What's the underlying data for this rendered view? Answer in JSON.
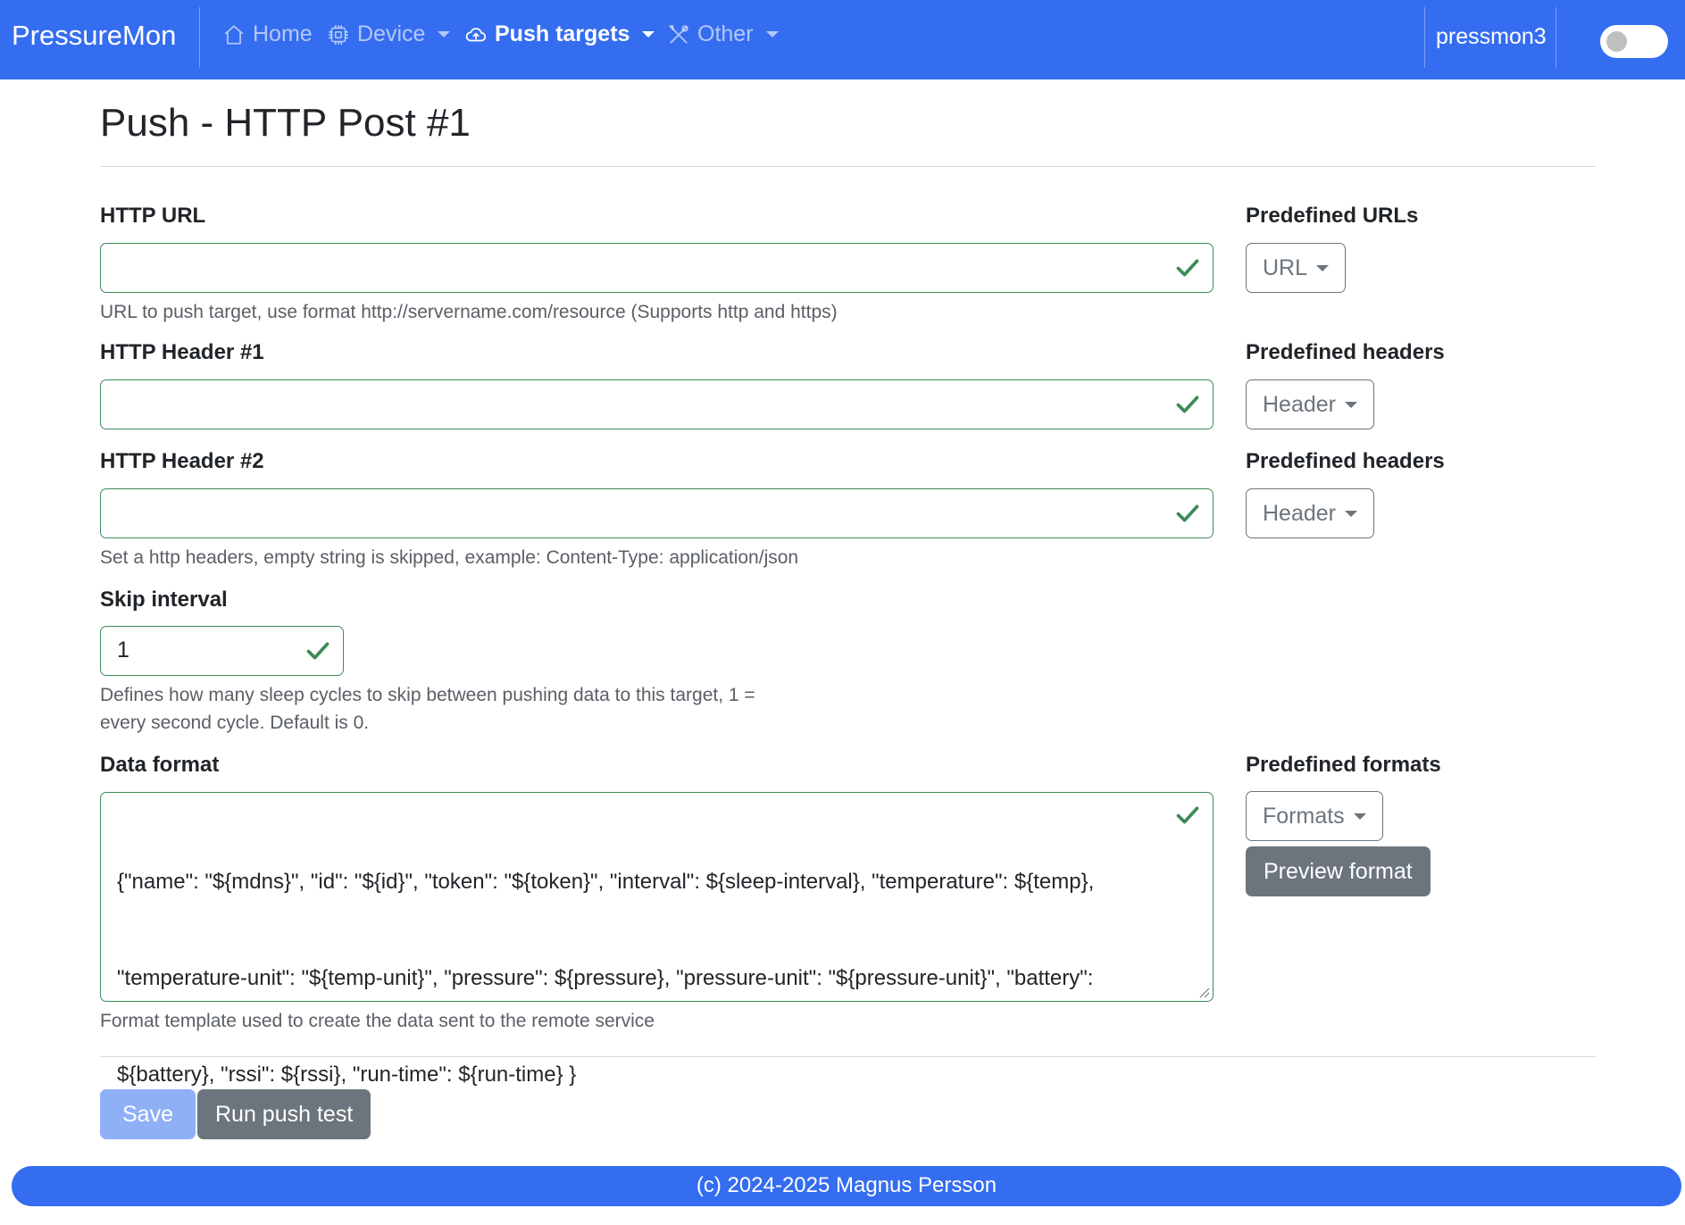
{
  "navbar": {
    "brand": "PressureMon",
    "items": [
      {
        "label": "Home",
        "icon": "house-icon",
        "active": false,
        "dropdown": false
      },
      {
        "label": "Device",
        "icon": "cpu-icon",
        "active": false,
        "dropdown": true
      },
      {
        "label": "Push targets",
        "icon": "cloud-upload-icon",
        "active": true,
        "dropdown": true
      },
      {
        "label": "Other",
        "icon": "tools-icon",
        "active": false,
        "dropdown": true
      }
    ],
    "hostname": "pressmon3",
    "theme_toggle": {
      "state": "off"
    }
  },
  "page": {
    "title": "Push - HTTP Post #1"
  },
  "form": {
    "url": {
      "label": "HTTP URL",
      "value": "",
      "help": "URL to push target, use format http://servername.com/resource (Supports http and https)"
    },
    "predefined_urls": {
      "label": "Predefined URLs",
      "button": "URL"
    },
    "header1": {
      "label": "HTTP Header #1",
      "value": ""
    },
    "predefined_headers1": {
      "label": "Predefined headers",
      "button": "Header"
    },
    "header2": {
      "label": "HTTP Header #2",
      "value": "",
      "help": "Set a http headers, empty string is skipped, example: Content-Type: application/json"
    },
    "predefined_headers2": {
      "label": "Predefined headers",
      "button": "Header"
    },
    "skip_interval": {
      "label": "Skip interval",
      "value": "1",
      "help_line1": "Defines how many sleep cycles to skip between pushing data to this target, 1 =",
      "help_line2": "every second cycle. Default is 0."
    },
    "data_format": {
      "label": "Data format",
      "line1": "{\"name\": \"${mdns}\", \"id\": \"${id}\", \"token\": \"${token}\", \"interval\": ${sleep-interval}, \"temperature\": ${temp},",
      "line2": "\"temperature-unit\": \"${temp-unit}\", \"pressure\": ${pressure}, \"pressure-unit\": \"${pressure-unit}\", \"battery\":",
      "line3": "${battery}, \"rssi\": ${rssi}, \"run-time\": ${run-time} }",
      "help": "Format template used to create the data sent to the remote service"
    },
    "predefined_formats": {
      "label": "Predefined formats",
      "button": "Formats",
      "preview": "Preview format"
    }
  },
  "actions": {
    "save": "Save",
    "run_test": "Run push test"
  },
  "footer": {
    "text": "(c) 2024-2025 Magnus Persson"
  },
  "colors": {
    "primary": "#356df0",
    "valid": "#3d8a58",
    "secondary": "#6c757d"
  }
}
